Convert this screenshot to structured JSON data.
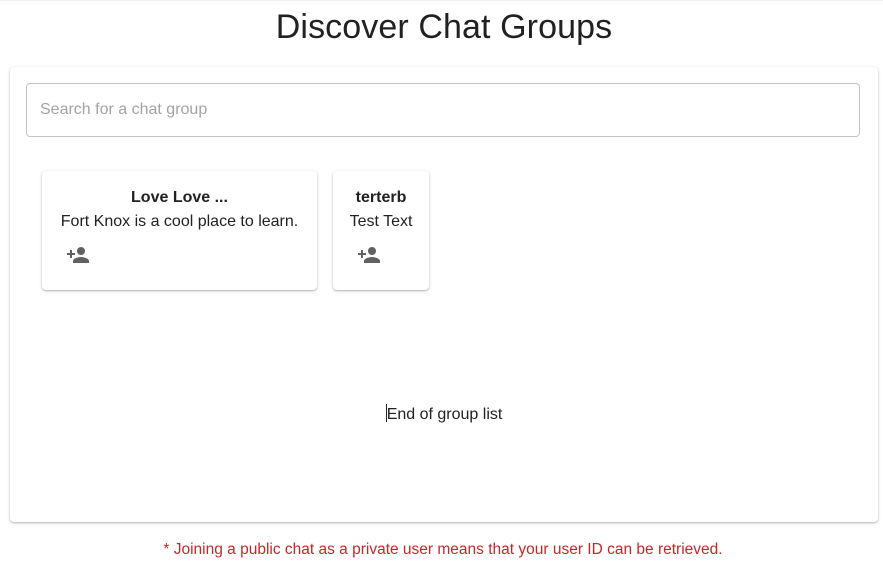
{
  "header": {
    "title": "Discover Chat Groups"
  },
  "search": {
    "placeholder": "Search for a chat group",
    "value": ""
  },
  "groups": [
    {
      "name": "Love Love ...",
      "description": "Fort Knox is a cool place to learn.",
      "action_icon": "person-add-icon"
    },
    {
      "name": "terterb",
      "description": "Test Text",
      "action_icon": "person-add-icon"
    }
  ],
  "list": {
    "end_text": "End of group list"
  },
  "footer": {
    "notice": "* Joining a public chat as a private user means that your user ID can be retrieved.",
    "notice_color": "#c62828"
  }
}
